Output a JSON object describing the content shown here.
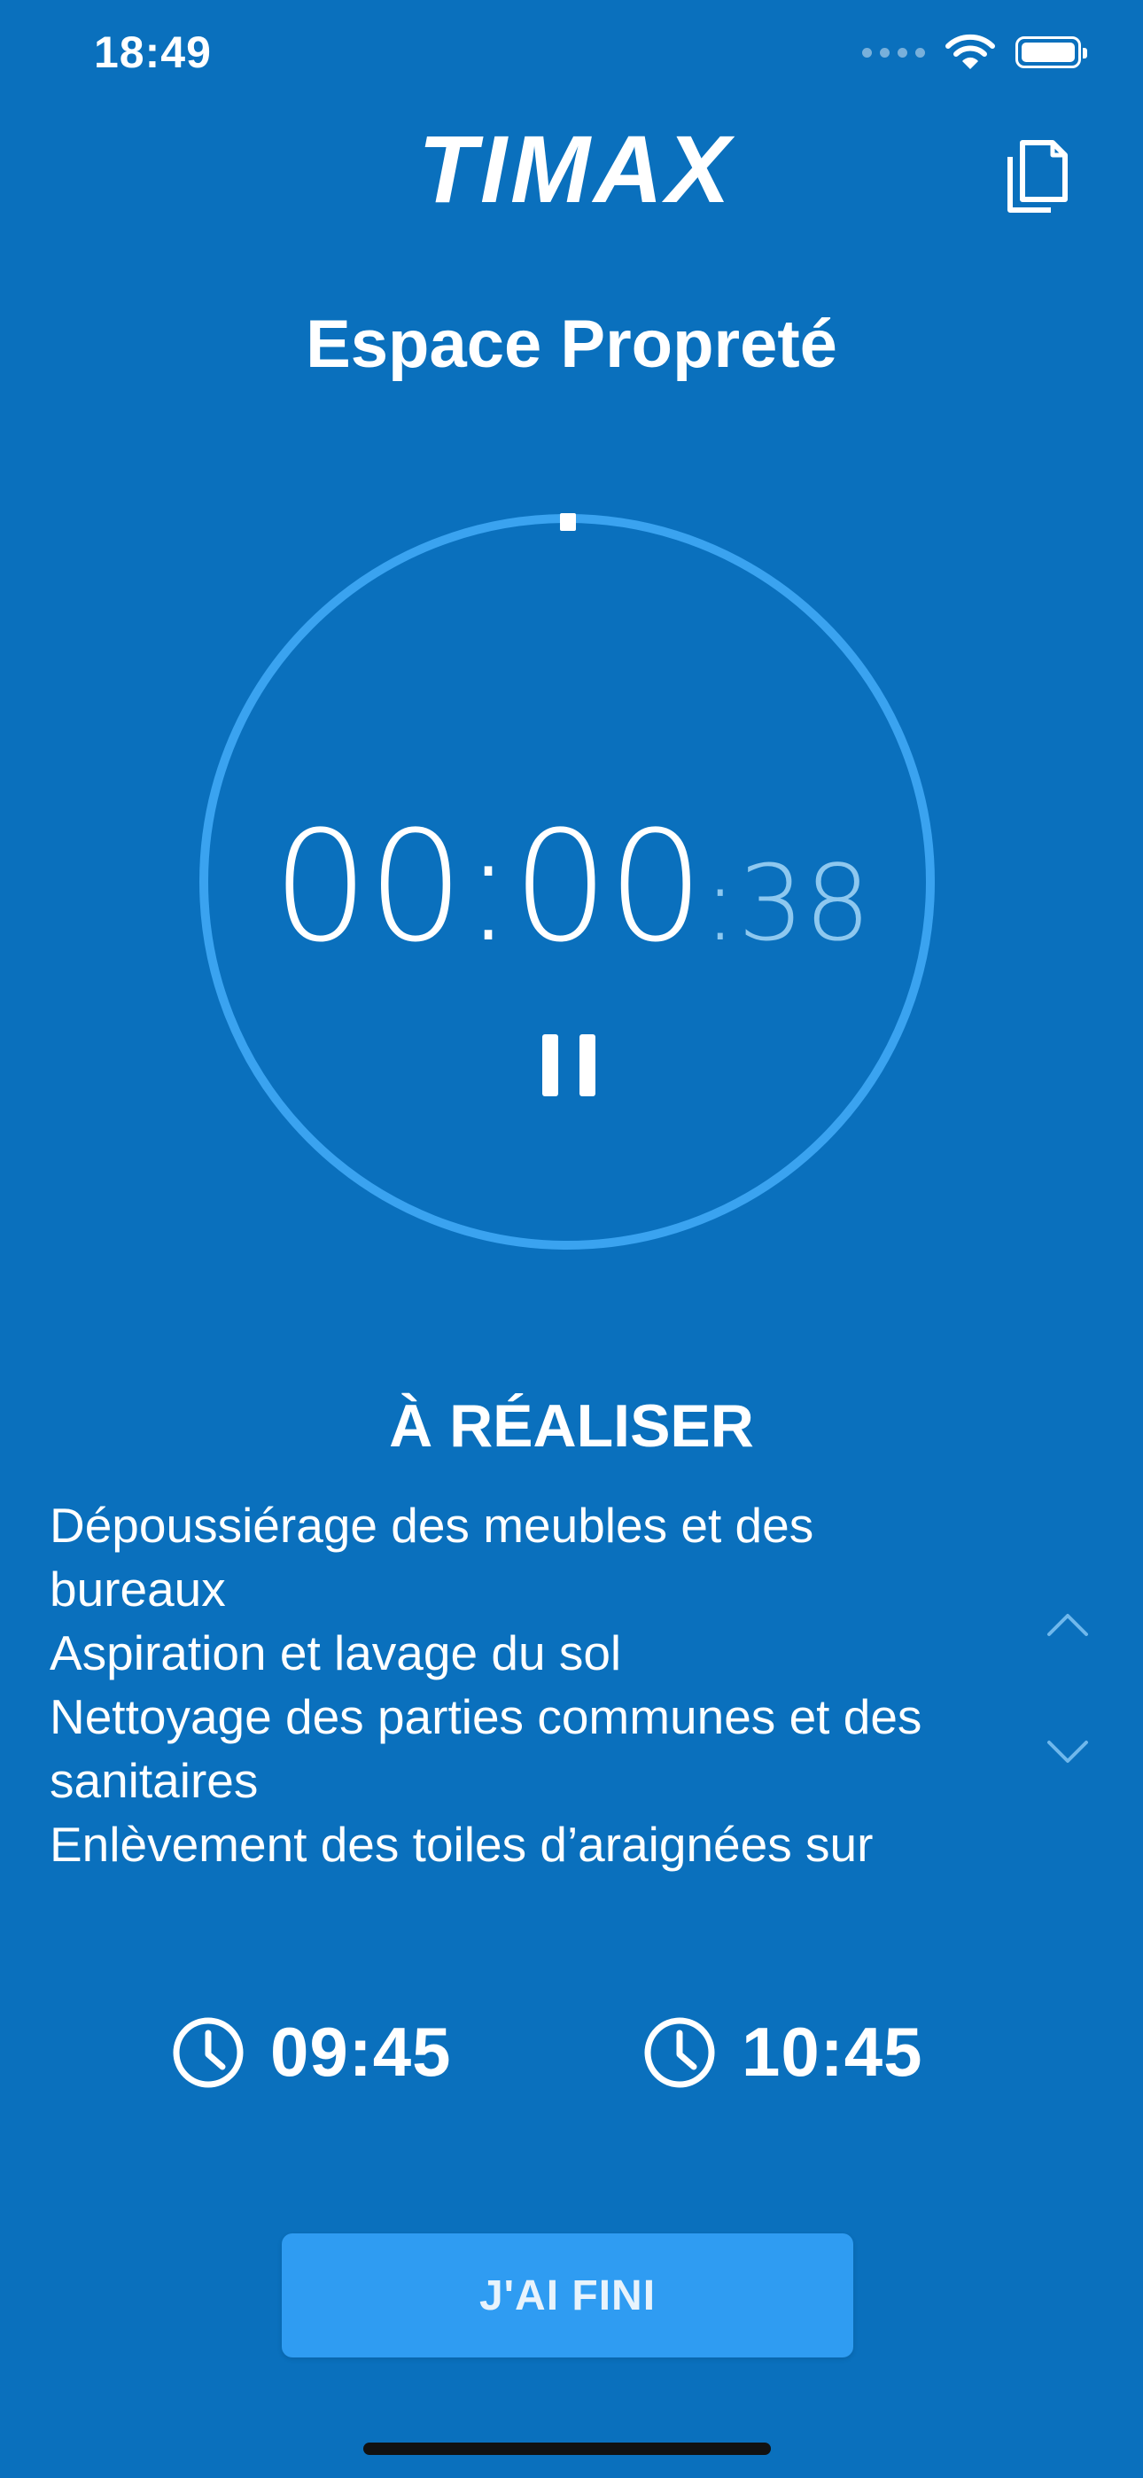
{
  "status_bar": {
    "time": "18:49"
  },
  "header": {
    "logo_text": "TIMAX",
    "title": "Espace Propreté"
  },
  "timer": {
    "hours_minutes": "00:00",
    "seconds": ":38",
    "progress_fraction": 0.01
  },
  "tasks": {
    "heading": "À RÉALISER",
    "items": [
      "Dépoussiérage des meubles et des bureaux",
      "Aspiration et lavage du sol",
      "Nettoyage des parties communes et des sanitaires",
      "Enlèvement des toiles d’araignées sur"
    ]
  },
  "schedule": {
    "start_time": "09:45",
    "end_time": "10:45"
  },
  "actions": {
    "done_label": "J'AI FINI"
  },
  "colors": {
    "background": "#0a70bd",
    "ring": "#3aa3f0",
    "button": "#2f9cf2"
  }
}
